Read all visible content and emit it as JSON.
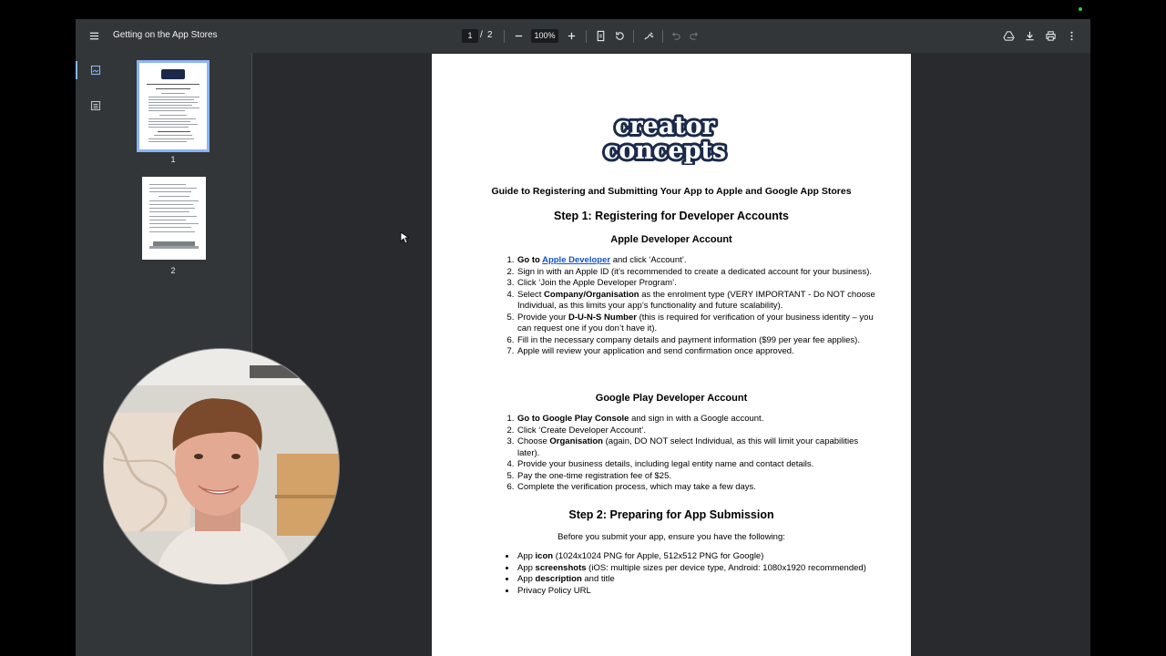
{
  "toolbar": {
    "doc_title": "Getting on the App Stores",
    "current_page": "1",
    "page_separator": "/",
    "total_pages": "2",
    "zoom": "100%"
  },
  "thumbnails": [
    {
      "label": "1",
      "selected": true
    },
    {
      "label": "2",
      "selected": false
    }
  ],
  "document": {
    "logo": {
      "line1": "creator",
      "line2": "concepts"
    },
    "title": "Guide to Registering and Submitting Your App to Apple and Google App Stores",
    "step1": {
      "heading": "Step 1: Registering for Developer Accounts",
      "apple": {
        "heading": "Apple Developer Account",
        "items": [
          {
            "pre": "Go to ",
            "link": "Apple Developer",
            "post": " and click ‘Account’."
          },
          {
            "text": "Sign in with an Apple ID (it’s recommended to create a dedicated account for your business)."
          },
          {
            "text": "Click ‘Join the Apple Developer Program’."
          },
          {
            "pre": "Select ",
            "bold": "Company/Organisation",
            "post": " as the enrolment type (VERY IMPORTANT - Do NOT choose Individual, as this limits your app’s functionality and future scalability)."
          },
          {
            "pre": "Provide your ",
            "bold": "D-U-N-S Number",
            "post": " (this is required for verification of your business identity – you can request one if you don’t have it)."
          },
          {
            "text": "Fill in the necessary company details and payment information ($99 per year fee applies)."
          },
          {
            "text": "Apple will review your application and send confirmation once approved."
          }
        ]
      },
      "google": {
        "heading": "Google Play Developer Account",
        "items": [
          {
            "pre": "",
            "bold": "Go to Google Play Console",
            "post": " and sign in with a Google account."
          },
          {
            "text": "Click ‘Create Developer Account’."
          },
          {
            "pre": "Choose ",
            "bold": "Organisation",
            "post": " (again, DO NOT select Individual, as this will limit your capabilities later)."
          },
          {
            "text": "Provide your business details, including legal entity name and contact details."
          },
          {
            "text": "Pay the one-time registration fee of $25."
          },
          {
            "text": "Complete the verification process, which may take a few days."
          }
        ]
      }
    },
    "step2": {
      "heading": "Step 2: Preparing for App Submission",
      "intro": "Before you submit your app, ensure you have the following:",
      "items": [
        {
          "pre": "App ",
          "bold": "icon",
          "post": " (1024x1024 PNG for Apple, 512x512 PNG for Google)"
        },
        {
          "pre": "App ",
          "bold": "screenshots",
          "post": " (iOS: multiple sizes per device type, Android: 1080x1920 recommended)"
        },
        {
          "pre": "App ",
          "bold": "description",
          "post": " and title"
        },
        {
          "text": "Privacy Policy URL"
        }
      ]
    }
  },
  "colors": {
    "viewer_bg": "#323639",
    "canvas_bg": "#282a2d",
    "accent": "#8ab4f8",
    "link": "#1155cc",
    "logo_navy": "#1b2a4a"
  },
  "icons": [
    "menu-icon",
    "zoom-out-icon",
    "zoom-in-icon",
    "fit-page-icon",
    "rotate-icon",
    "annotate-icon",
    "undo-icon",
    "redo-icon",
    "drive-icon",
    "download-icon",
    "print-icon",
    "more-vert-icon",
    "thumbnails-icon",
    "outline-icon"
  ]
}
